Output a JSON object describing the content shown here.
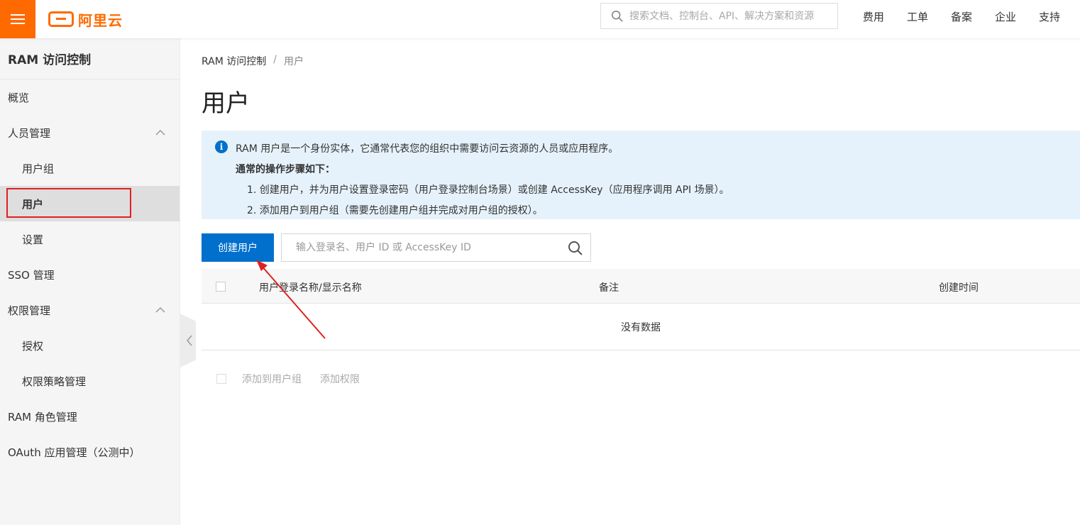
{
  "brand": {
    "logo_text": "阿里云",
    "accent": "#ff6a00"
  },
  "header": {
    "search_placeholder": "搜索文档、控制台、API、解决方案和资源",
    "nav": [
      "费用",
      "工单",
      "备案",
      "企业",
      "支持"
    ]
  },
  "sidebar": {
    "title": "RAM 访问控制",
    "items": [
      {
        "label": "概览"
      },
      {
        "label": "人员管理"
      },
      {
        "label": "用户组"
      },
      {
        "label": "用户"
      },
      {
        "label": "设置"
      },
      {
        "label": "SSO 管理"
      },
      {
        "label": "权限管理"
      },
      {
        "label": "授权"
      },
      {
        "label": "权限策略管理"
      },
      {
        "label": "RAM 角色管理"
      },
      {
        "label": "OAuth 应用管理（公测中）"
      }
    ]
  },
  "breadcrumb": {
    "root": "RAM 访问控制",
    "separator": "/",
    "current": "用户"
  },
  "page_title": "用户",
  "notice": {
    "line1": "RAM 用户是一个身份实体，它通常代表您的组织中需要访问云资源的人员或应用程序。",
    "line2": "通常的操作步骤如下：",
    "step1": "1. 创建用户，并为用户设置登录密码（用户登录控制台场景）或创建 AccessKey（应用程序调用 API 场景）。",
    "step2": "2. 添加用户到用户组（需要先创建用户组并完成对用户组的授权）。"
  },
  "toolbar": {
    "create_label": "创建用户",
    "search_placeholder": "输入登录名、用户 ID 或 AccessKey ID"
  },
  "table": {
    "columns": [
      "用户登录名称/显示名称",
      "备注",
      "创建时间"
    ],
    "empty_text": "没有数据"
  },
  "batch_actions": [
    "添加到用户组",
    "添加权限"
  ],
  "colors": {
    "primary": "#0070cc",
    "annotation": "#e02020",
    "notice_bg": "#e6f2fb"
  }
}
